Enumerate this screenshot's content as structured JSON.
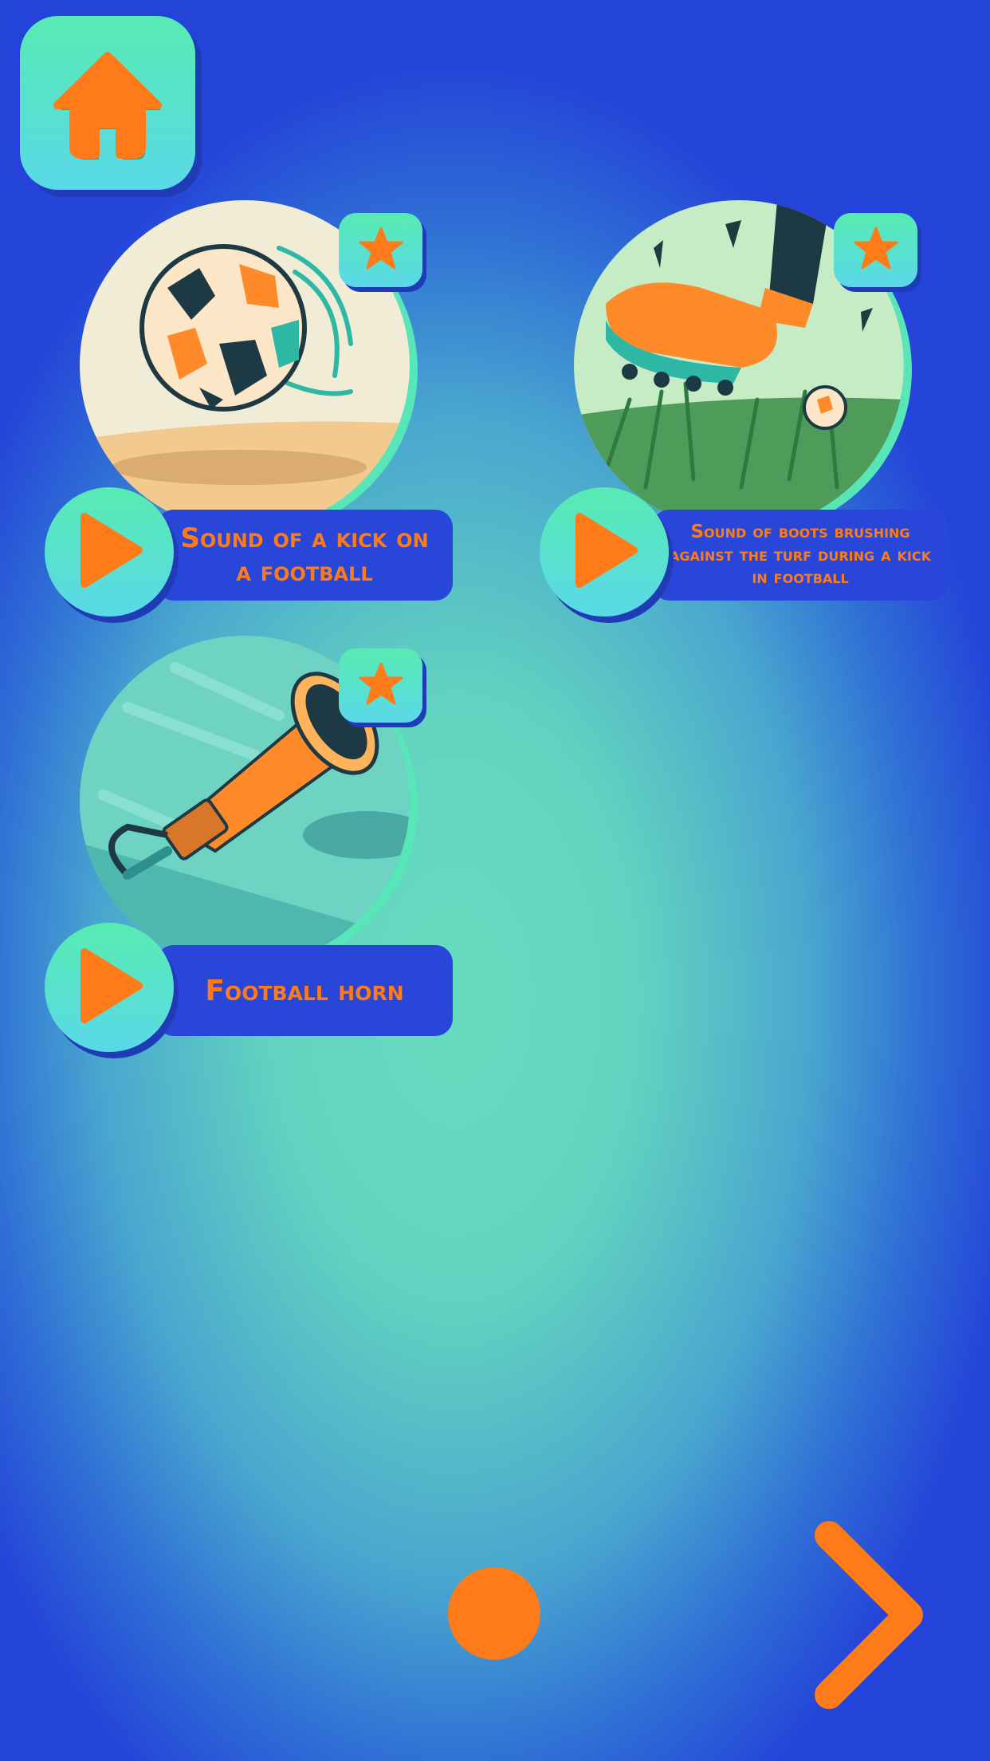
{
  "colors": {
    "accent_orange": "#ff7a18",
    "button_mint": "#57ebb2",
    "label_blue": "#2846d8",
    "background_edge_blue": "#2443d8",
    "background_center_teal": "#67dbbf"
  },
  "header": {
    "home_icon": "home-icon"
  },
  "sounds": [
    {
      "label": "Sound of a kick on a football",
      "image": "football-kick-illustration",
      "favorite_icon": "star-icon",
      "play_icon": "play-icon"
    },
    {
      "label": "Sound of boots brushing against the turf during a kick in football",
      "image": "boot-kick-turf-illustration",
      "favorite_icon": "star-icon",
      "play_icon": "play-icon"
    },
    {
      "label": "Football horn",
      "image": "football-horn-illustration",
      "favorite_icon": "star-icon",
      "play_icon": "play-icon"
    }
  ],
  "pager": {
    "current_page_indicator": "page-dot",
    "next_icon": "chevron-right-icon"
  }
}
